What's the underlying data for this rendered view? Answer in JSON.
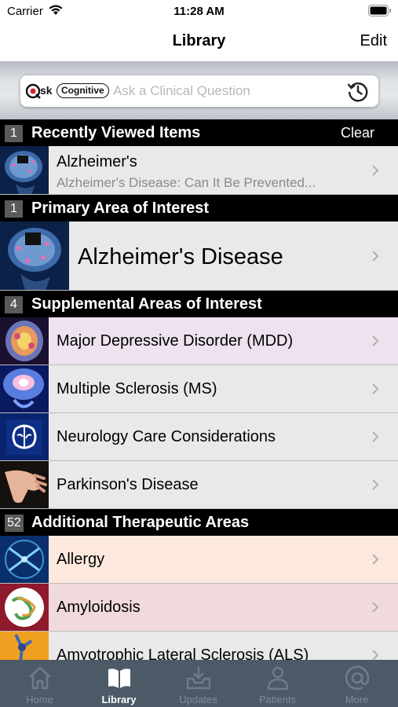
{
  "status_bar": {
    "carrier": "Carrier",
    "time": "11:28 AM"
  },
  "nav": {
    "title": "Library",
    "edit_label": "Edit"
  },
  "search": {
    "logo_ask": "sk",
    "logo_cognitive": "Cognitive",
    "placeholder": "Ask a Clinical Question"
  },
  "recent": {
    "count": "1",
    "title": "Recently Viewed Items",
    "clear_label": "Clear",
    "items": [
      {
        "label": "Alzheimer's",
        "sublabel": "Alzheimer's Disease: Can It Be Prevented..."
      }
    ]
  },
  "primary": {
    "count": "1",
    "title": "Primary Area of Interest",
    "items": [
      {
        "label": "Alzheimer's Disease"
      }
    ]
  },
  "supplemental": {
    "count": "4",
    "title": "Supplemental Areas of Interest",
    "items": [
      {
        "label": "Major Depressive Disorder (MDD)",
        "color": "#eee2ef"
      },
      {
        "label": "Multiple Sclerosis (MS)",
        "color": "#e9e9e9"
      },
      {
        "label": "Neurology Care Considerations",
        "color": "#e9e9e9"
      },
      {
        "label": "Parkinson's Disease",
        "color": "#e9e9e9"
      }
    ]
  },
  "additional": {
    "count": "52",
    "title": "Additional Therapeutic Areas",
    "items": [
      {
        "label": "Allergy",
        "color": "#fce8dd"
      },
      {
        "label": "Amyloidosis",
        "color": "#f0dadd"
      },
      {
        "label": "Amyotrophic Lateral Sclerosis (ALS)",
        "color": "#e9e9e9"
      }
    ]
  },
  "tabs": [
    {
      "label": "Home",
      "icon": "home-icon"
    },
    {
      "label": "Library",
      "icon": "book-icon",
      "active": true
    },
    {
      "label": "Updates",
      "icon": "inbox-download-icon"
    },
    {
      "label": "Patients",
      "icon": "person-icon"
    },
    {
      "label": "More",
      "icon": "at-sign-icon"
    }
  ],
  "colors": {
    "header_bg": "#000000",
    "tab_bar_bg": "#4c5a68",
    "row_bg": "#e9e9e9"
  }
}
